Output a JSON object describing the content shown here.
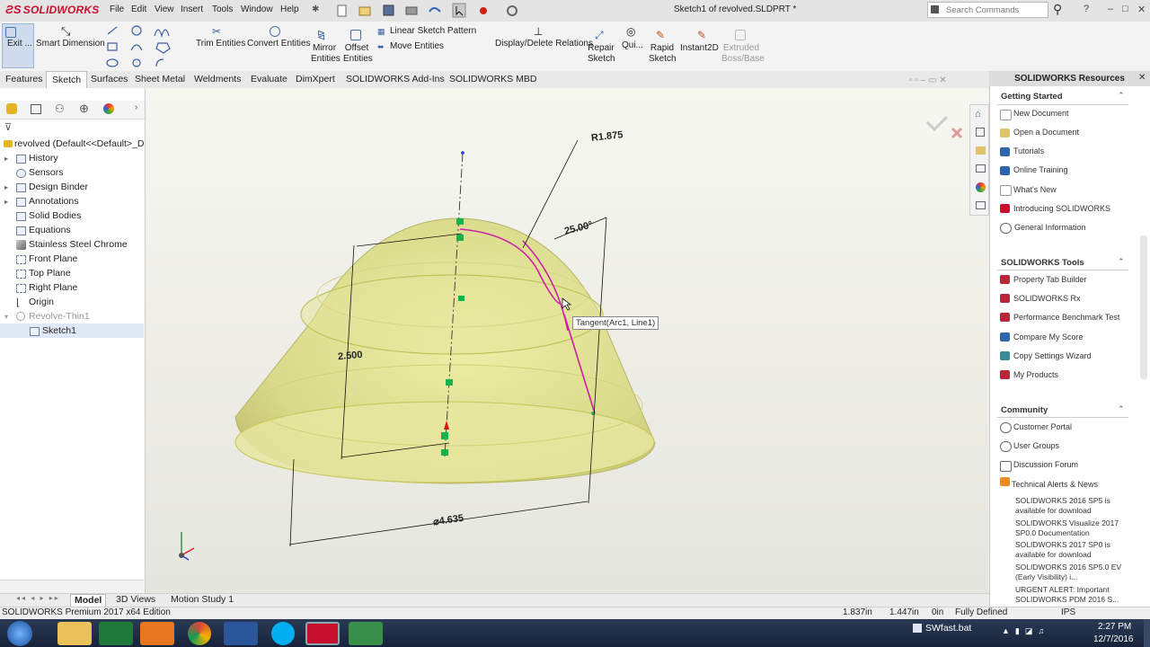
{
  "app": {
    "logo_text": "SOLIDWORKS",
    "document_title": "Sketch1 of revolved.SLDPRT *"
  },
  "menu": {
    "items": [
      "File",
      "Edit",
      "View",
      "Insert",
      "Tools",
      "Window",
      "Help"
    ]
  },
  "search": {
    "placeholder": "Search Commands"
  },
  "command_manager": {
    "exit_sketch": "Exit ...",
    "smart_dimension": "Smart Dimension",
    "trim_entities": "Trim Entities",
    "convert_entities": "Convert Entities",
    "mirror_entities": "Mirror Entities",
    "offset_entities": "Offset Entities",
    "linear_sketch_pattern": "Linear Sketch Pattern",
    "move_entities": "Move Entities",
    "display_delete_relations": "Display/Delete Relations",
    "repair_sketch": "Repair Sketch",
    "quick_snaps": "Qui...",
    "rapid_sketch": "Rapid Sketch",
    "instant2d": "Instant2D",
    "extruded_boss": "Extruded Boss/Base"
  },
  "tabs": [
    "Features",
    "Sketch",
    "Surfaces",
    "Sheet Metal",
    "Weldments",
    "Evaluate",
    "DimXpert",
    "SOLIDWORKS Add-Ins",
    "SOLIDWORKS MBD"
  ],
  "active_tab": "Sketch",
  "feature_tree": {
    "root": "revolved  (Default<<Default>_D",
    "items": [
      "History",
      "Sensors",
      "Design Binder",
      "Annotations",
      "Solid Bodies",
      "Equations",
      "Stainless Steel Chrome",
      "Front Plane",
      "Top Plane",
      "Right Plane",
      "Origin",
      "Revolve-Thin1",
      "Sketch1"
    ]
  },
  "viewport": {
    "dim_radius": "R1.875",
    "dim_angle": "25.00°",
    "dim_height": "2.500",
    "dim_diameter": "⌀4.635",
    "tooltip": "Tangent(Arc1, Line1)",
    "shape_color": "#dede8a",
    "sketch_color": "#cc1fa6"
  },
  "task_pane": {
    "title": "SOLIDWORKS Resources",
    "getting_started": {
      "title": "Getting Started",
      "items": [
        "New Document",
        "Open a Document",
        "Tutorials",
        "Online Training",
        "What's New",
        "Introducing SOLIDWORKS",
        "General Information"
      ]
    },
    "tools": {
      "title": "SOLIDWORKS Tools",
      "items": [
        "Property Tab Builder",
        "SOLIDWORKS Rx",
        "Performance Benchmark Test",
        "Compare My Score",
        "Copy Settings Wizard",
        "My Products"
      ]
    },
    "community": {
      "title": "Community",
      "items": [
        "Customer Portal",
        "User Groups",
        "Discussion Forum",
        "Technical Alerts & News"
      ]
    },
    "news": [
      "SOLIDWORKS 2016 SP5 is available for download",
      "SOLIDWORKS Visualize 2017 SP0.0 Documentation",
      "SOLIDWORKS 2017 SP0 is available for download",
      "SOLIDWORKS 2016 SP5.0 EV (Early Visibility) i...",
      "URGENT ALERT: Important SOLIDWORKS PDM 2016 S..."
    ]
  },
  "bottom_tabs": [
    "Model",
    "3D Views",
    "Motion Study 1"
  ],
  "status": {
    "edition": "SOLIDWORKS Premium 2017 x64 Edition",
    "x": "1.837in",
    "y": "1.447in",
    "z": "0in",
    "state": "Fully Defined",
    "units": "IPS"
  },
  "taskbar": {
    "app_label": "SWfast.bat",
    "time": "2:27 PM",
    "date": "12/7/2016"
  }
}
